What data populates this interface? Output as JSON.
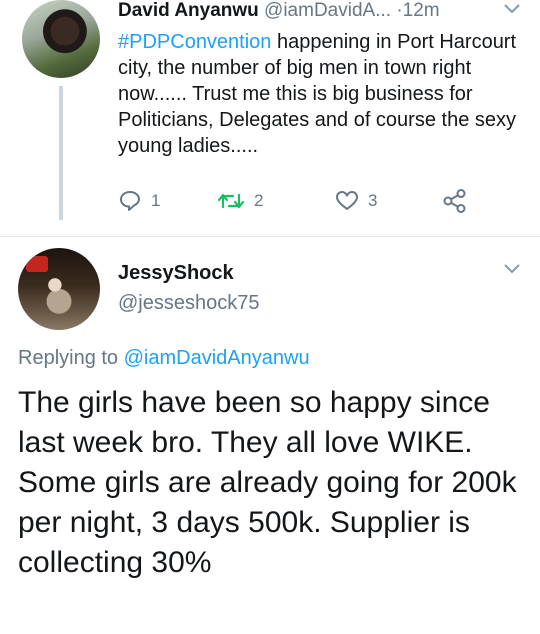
{
  "tweet1": {
    "name": "David Anyanwu",
    "handle": "@iamDavidA...",
    "separator": "·",
    "time": "12m",
    "hashtag": "#PDPConvention",
    "text": " happening in Port Harcourt city, the number of big men in town right now...... Trust me this is big business for Politicians, Delegates and of course the sexy young ladies.....",
    "actions": {
      "reply_count": "1",
      "retweet_count": "2",
      "like_count": "3"
    }
  },
  "tweet2": {
    "name": "JessyShock",
    "handle": "@jesseshock75",
    "replying_prefix": "Replying to ",
    "replying_to": "@iamDavidAnyanwu",
    "lines": [
      "The girls have been so happy since last week bro. They all love WIKE.",
      "Some girls are already going for 200k per night, 3 days 500k. Supplier is collecting 30%"
    ]
  },
  "colors": {
    "accent": "#1da1f2",
    "retweet": "#17bf63",
    "muted": "#657786",
    "text": "#14171a"
  },
  "icons": [
    "chevron-down-icon",
    "reply-icon",
    "retweet-icon",
    "heart-icon",
    "share-icon"
  ]
}
